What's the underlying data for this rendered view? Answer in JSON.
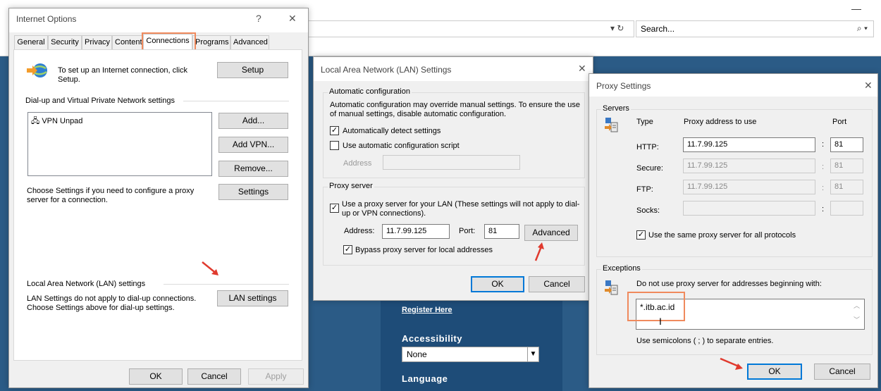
{
  "browser": {
    "search_placeholder": "Search...",
    "refresh_symbol": "▾ ↻",
    "search_icon": "⌕ ▾",
    "minimize_symbol": "—",
    "page": {
      "register_link": "Register Here",
      "accessibility_label": "Accessibility",
      "accessibility_value": "None",
      "language_label": "Language"
    }
  },
  "internet_options": {
    "title": "Internet Options",
    "help_symbol": "?",
    "close_symbol": "✕",
    "tabs": [
      {
        "label": "General"
      },
      {
        "label": "Security"
      },
      {
        "label": "Privacy"
      },
      {
        "label": "Content"
      },
      {
        "label": "Connections"
      },
      {
        "label": "Programs"
      },
      {
        "label": "Advanced"
      }
    ],
    "active_tab": "Connections",
    "setup_text": "To set up an Internet connection, click Setup.",
    "setup_button": "Setup",
    "dialup_heading": "Dial-up and Virtual Private Network settings",
    "vpn_items": [
      "VPN Unpad"
    ],
    "add_button": "Add...",
    "add_vpn_button": "Add VPN...",
    "remove_button": "Remove...",
    "settings_text": "Choose Settings if you need to configure a proxy server for a connection.",
    "settings_button": "Settings",
    "lan_heading": "Local Area Network (LAN) settings",
    "lan_text": "LAN Settings do not apply to dial-up connections. Choose Settings above for dial-up settings.",
    "lan_settings_button": "LAN settings",
    "ok_button": "OK",
    "cancel_button": "Cancel",
    "apply_button": "Apply"
  },
  "lan_settings": {
    "title": "Local Area Network (LAN) Settings",
    "close_symbol": "✕",
    "auto_config_heading": "Automatic configuration",
    "auto_config_text": "Automatic configuration may override manual settings.  To ensure the use of manual settings, disable automatic configuration.",
    "auto_detect_label": "Automatically detect settings",
    "auto_detect_checked": true,
    "auto_script_label": "Use automatic configuration script",
    "auto_script_checked": false,
    "address_label": "Address",
    "proxy_heading": "Proxy server",
    "use_proxy_label": "Use a proxy server for your LAN (These settings will not apply to dial-up or VPN connections).",
    "use_proxy_checked": true,
    "proxy_address_label": "Address:",
    "proxy_address_value": "11.7.99.125",
    "proxy_port_label": "Port:",
    "proxy_port_value": "81",
    "advanced_button": "Advanced",
    "bypass_label": "Bypass proxy server for local addresses",
    "bypass_checked": true,
    "ok_button": "OK",
    "cancel_button": "Cancel"
  },
  "proxy_settings": {
    "title": "Proxy Settings",
    "close_symbol": "✕",
    "servers_heading": "Servers",
    "col_type": "Type",
    "col_address": "Proxy address to use",
    "col_port": "Port",
    "rows": [
      {
        "type": "HTTP:",
        "address": "11.7.99.125",
        "port": "81",
        "enabled": true
      },
      {
        "type": "Secure:",
        "address": "11.7.99.125",
        "port": "81",
        "enabled": false
      },
      {
        "type": "FTP:",
        "address": "11.7.99.125",
        "port": "81",
        "enabled": false
      },
      {
        "type": "Socks:",
        "address": "",
        "port": "",
        "enabled": false
      }
    ],
    "same_proxy_label": "Use the same proxy server for all protocols",
    "same_proxy_checked": true,
    "exceptions_heading": "Exceptions",
    "exceptions_text": "Do not use proxy server for addresses beginning with:",
    "exceptions_value": "*.itb.ac.id",
    "semicolon_note": "Use semicolons ( ; ) to separate entries.",
    "ok_button": "OK",
    "cancel_button": "Cancel"
  },
  "colors": {
    "highlight": "#f08a5d",
    "page_bg": "#2b5b86",
    "dialog_bg": "#f0f0f0",
    "focus_blue": "#0078d7"
  }
}
